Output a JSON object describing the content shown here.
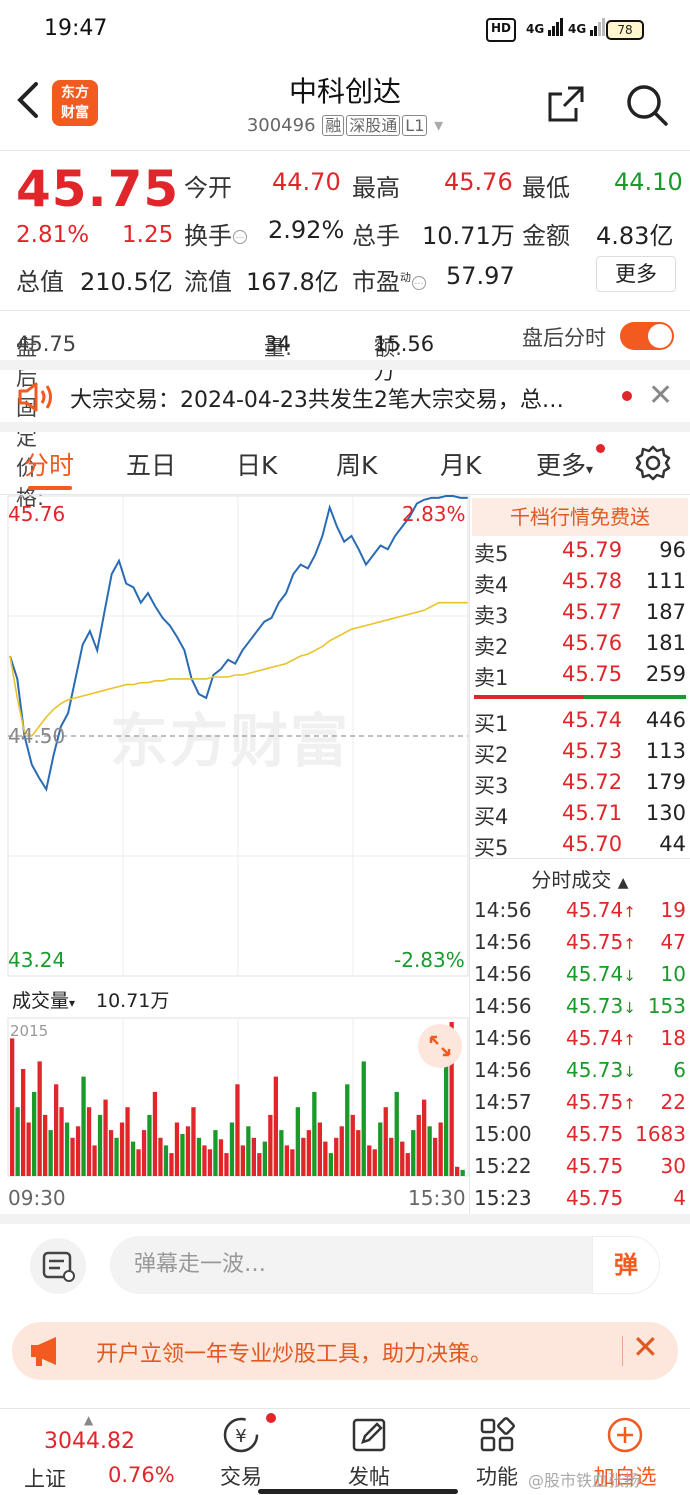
{
  "status": {
    "time": "19:47",
    "hd": "HD",
    "net1": "4G",
    "net2": "4G",
    "battery": "78"
  },
  "header": {
    "logo_line1": "东方",
    "logo_line2": "财富",
    "stock_name": "中科创达",
    "stock_code": "300496",
    "tag_margin": "融",
    "tag_connect": "深股通",
    "tag_level": "L1"
  },
  "quote": {
    "price": "45.75",
    "change_pct": "2.81%",
    "change": "1.25",
    "open_label": "今开",
    "open": "44.70",
    "high_label": "最高",
    "high": "45.76",
    "low_label": "最低",
    "low": "44.10",
    "turnover_label": "换手",
    "turnover": "2.92%",
    "volume_label": "总手",
    "volume": "10.71万",
    "amount_label": "金额",
    "amount": "4.83亿",
    "mktcap_label": "总值",
    "mktcap": "210.5亿",
    "float_label": "流值",
    "float": "167.8亿",
    "pe_label": "市盈",
    "pe_sup": "动",
    "pe": "57.97",
    "more": "更多",
    "colors": {
      "up": "#e0262a",
      "down": "#1a9a2a",
      "accent": "#f25a1f"
    }
  },
  "after_hours": {
    "fixed_price_label": "盘后固定价格:",
    "fixed_price": "45.75",
    "vol_label": "量:",
    "vol": "34",
    "amt_label": "额:",
    "amt": "15.56万",
    "toggle_label": "盘后分时"
  },
  "notice": {
    "text": "大宗交易：2024-04-23共发生2笔大宗交易，总…"
  },
  "tabs": [
    "分时",
    "五日",
    "日K",
    "周K",
    "月K",
    "更多"
  ],
  "chart_labels": {
    "top_price": "45.76",
    "top_pct": "2.83%",
    "mid_price": "44.50",
    "bottom_price": "43.24",
    "bottom_pct": "-2.83%",
    "vol_label": "成交量",
    "vol_total": "10.71万",
    "vol_max": "2015",
    "time_start": "09:30",
    "time_end": "15:30",
    "watermark": "东方财富"
  },
  "chart_data": {
    "type": "line",
    "ylim": [
      43.24,
      45.76
    ],
    "reference": 44.5,
    "x_range": [
      "09:30",
      "15:30"
    ],
    "series": [
      {
        "values": [
          44.92,
          44.8,
          44.5,
          44.35,
          44.28,
          44.22,
          44.4,
          44.55,
          44.62,
          44.8,
          44.98,
          45.05,
          44.95,
          45.15,
          45.35,
          45.42,
          45.3,
          45.28,
          45.2,
          45.25,
          45.18,
          45.12,
          45.08,
          45.02,
          44.95,
          44.8,
          44.72,
          44.7,
          44.82,
          44.85,
          44.9,
          44.88,
          44.95,
          45.0,
          45.05,
          45.1,
          45.12,
          45.2,
          45.25,
          45.35,
          45.4,
          45.38,
          45.45,
          45.55,
          45.7,
          45.6,
          45.52,
          45.55,
          45.48,
          45.4,
          45.45,
          45.5,
          45.48,
          45.55,
          45.6,
          45.65,
          45.72,
          45.74,
          45.75,
          45.75,
          45.76,
          45.76,
          45.75,
          45.75
        ]
      },
      {
        "values": [
          44.92,
          44.7,
          44.52,
          44.5,
          44.55,
          44.6,
          44.64,
          44.67,
          44.69,
          44.7,
          44.71,
          44.72,
          44.73,
          44.74,
          44.75,
          44.76,
          44.77,
          44.77,
          44.78,
          44.78,
          44.79,
          44.79,
          44.8,
          44.8,
          44.8,
          44.8,
          44.8,
          44.8,
          44.81,
          44.81,
          44.81,
          44.82,
          44.82,
          44.83,
          44.84,
          44.85,
          44.86,
          44.87,
          44.88,
          44.9,
          44.92,
          44.93,
          44.95,
          44.97,
          45.0,
          45.02,
          45.04,
          45.06,
          45.07,
          45.08,
          45.09,
          45.1,
          45.11,
          45.12,
          45.13,
          45.14,
          45.15,
          45.16,
          45.18,
          45.2,
          45.2,
          45.2,
          45.2,
          45.2
        ]
      }
    ],
    "volume_max": 2015,
    "volume": [
      1800,
      900,
      1400,
      700,
      1100,
      1500,
      800,
      600,
      1200,
      900,
      700,
      500,
      650,
      1300,
      900,
      400,
      800,
      1000,
      600,
      500,
      700,
      900,
      450,
      350,
      600,
      800,
      1100,
      500,
      400,
      300,
      700,
      550,
      650,
      900,
      500,
      400,
      350,
      600,
      480,
      300,
      700,
      1200,
      400,
      650,
      500,
      300,
      450,
      800,
      1300,
      600,
      400,
      350,
      900,
      500,
      600,
      1100,
      700,
      450,
      300,
      500,
      650,
      1200,
      800,
      600,
      1500,
      400,
      350,
      700,
      900,
      500,
      1100,
      450,
      300,
      600,
      800,
      1000,
      650,
      500,
      700,
      1900,
      2015,
      120,
      80
    ],
    "volume_colors": "alternating red (up) / green (down)"
  },
  "book": {
    "banner": "千档行情免费送",
    "asks": [
      {
        "label": "卖5",
        "price": "45.79",
        "vol": "96"
      },
      {
        "label": "卖4",
        "price": "45.78",
        "vol": "111"
      },
      {
        "label": "卖3",
        "price": "45.77",
        "vol": "187"
      },
      {
        "label": "卖2",
        "price": "45.76",
        "vol": "181"
      },
      {
        "label": "卖1",
        "price": "45.75",
        "vol": "259"
      }
    ],
    "bids": [
      {
        "label": "买1",
        "price": "45.74",
        "vol": "446"
      },
      {
        "label": "买2",
        "price": "45.73",
        "vol": "113"
      },
      {
        "label": "买3",
        "price": "45.72",
        "vol": "179"
      },
      {
        "label": "买4",
        "price": "45.71",
        "vol": "130"
      },
      {
        "label": "买5",
        "price": "45.70",
        "vol": "44"
      }
    ],
    "trades_title": "分时成交",
    "trades": [
      {
        "time": "14:56",
        "price": "45.74",
        "dir": "up",
        "vol": "19"
      },
      {
        "time": "14:56",
        "price": "45.75",
        "dir": "up",
        "vol": "47"
      },
      {
        "time": "14:56",
        "price": "45.74",
        "dir": "down",
        "vol": "10"
      },
      {
        "time": "14:56",
        "price": "45.73",
        "dir": "down",
        "vol": "153"
      },
      {
        "time": "14:56",
        "price": "45.74",
        "dir": "up",
        "vol": "18"
      },
      {
        "time": "14:56",
        "price": "45.73",
        "dir": "down",
        "vol": "6"
      },
      {
        "time": "14:57",
        "price": "45.75",
        "dir": "up",
        "vol": "22"
      },
      {
        "time": "15:00",
        "price": "45.75",
        "dir": "none",
        "vol": "1683"
      },
      {
        "time": "15:22",
        "price": "45.75",
        "dir": "none",
        "vol": "30"
      },
      {
        "time": "15:23",
        "price": "45.75",
        "dir": "none",
        "vol": "4"
      }
    ]
  },
  "danmu": {
    "placeholder": "弹幕走一波…",
    "button": "弹"
  },
  "promo": {
    "text": "开户立领一年专业炒股工具，助力决策。"
  },
  "nav": {
    "index_value": "3044.82",
    "index_name": "上证",
    "index_pct": "0.76%",
    "items": [
      "交易",
      "发帖",
      "功能",
      "加自选"
    ],
    "watermark": "@股市铁血张扬"
  }
}
